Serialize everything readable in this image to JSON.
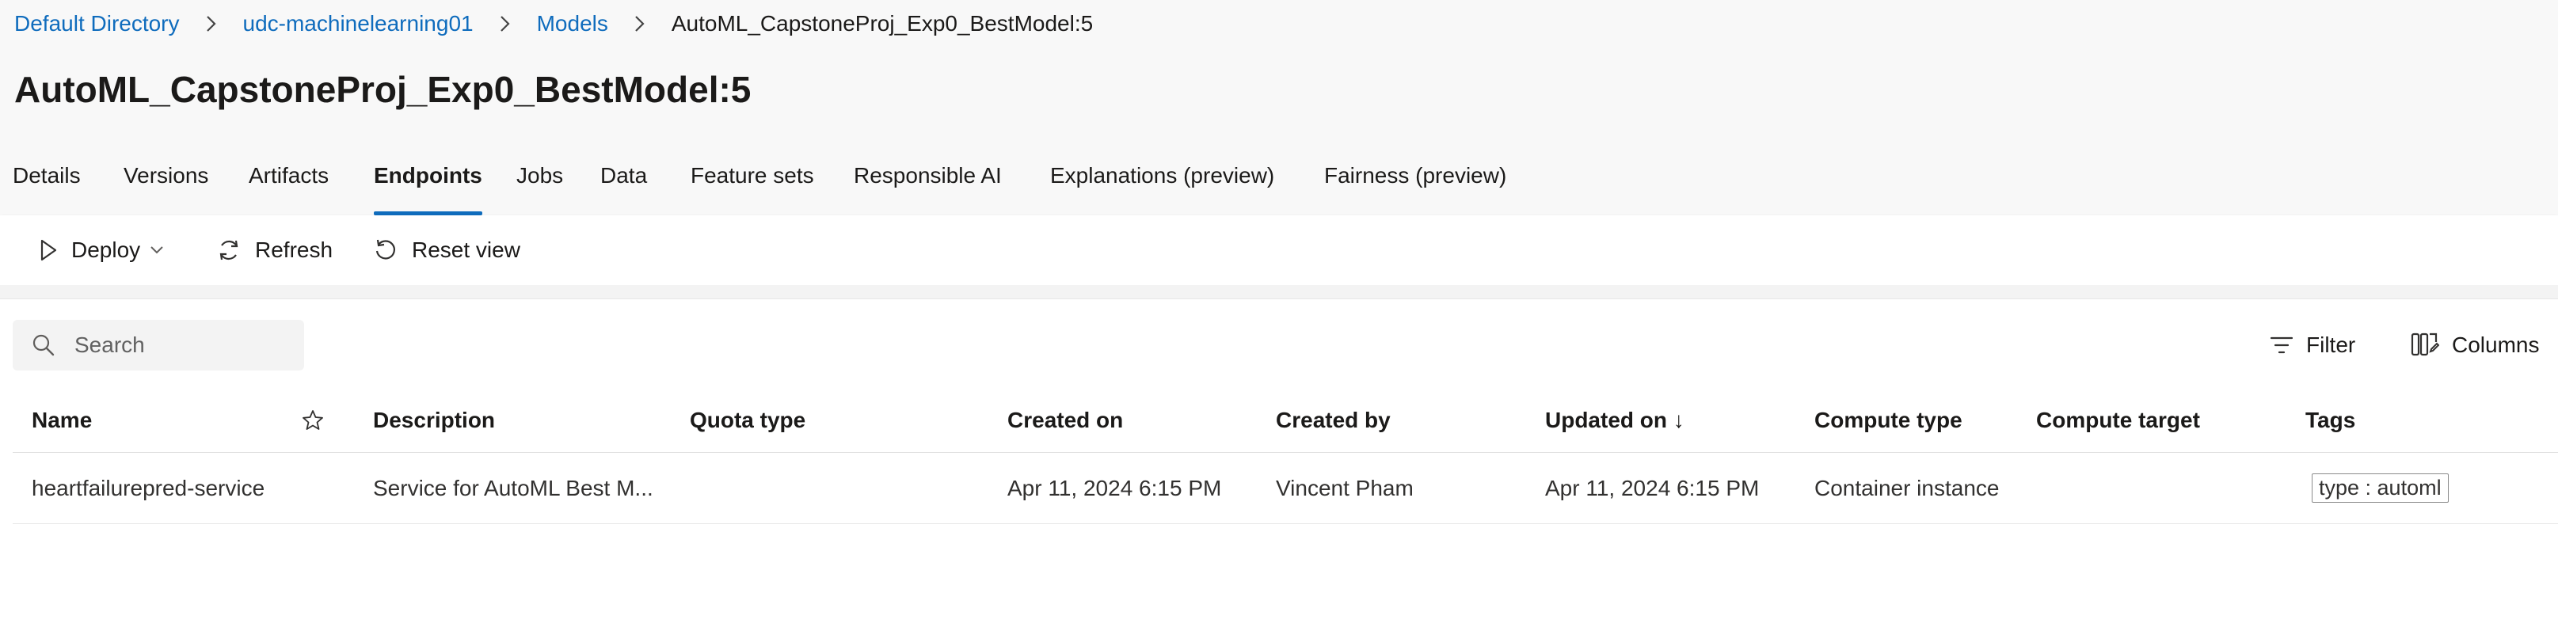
{
  "breadcrumb": {
    "items": [
      "Default Directory",
      "udc-machinelearning01",
      "Models"
    ],
    "current": "AutoML_CapstoneProj_Exp0_BestModel:5"
  },
  "page": {
    "title": "AutoML_CapstoneProj_Exp0_BestModel:5"
  },
  "tabs": [
    {
      "label": "Details"
    },
    {
      "label": "Versions"
    },
    {
      "label": "Artifacts"
    },
    {
      "label": "Endpoints",
      "active": true
    },
    {
      "label": "Jobs"
    },
    {
      "label": "Data"
    },
    {
      "label": "Feature sets"
    },
    {
      "label": "Responsible AI"
    },
    {
      "label": "Explanations (preview)"
    },
    {
      "label": "Fairness (preview)"
    }
  ],
  "toolbar": {
    "deploy_label": "Deploy",
    "refresh_label": "Refresh",
    "reset_view_label": "Reset view"
  },
  "search": {
    "placeholder": "Search",
    "value": ""
  },
  "actions": {
    "filter_label": "Filter",
    "columns_label": "Columns"
  },
  "table": {
    "columns": [
      "Name",
      "Description",
      "Quota type",
      "Created on",
      "Created by",
      "Updated on ↓",
      "Compute type",
      "Compute target",
      "Tags"
    ],
    "rows": [
      {
        "name": "heartfailurepred-service",
        "description": "Service for AutoML Best M...",
        "quota_type": "",
        "created_on": "Apr 11, 2024 6:15 PM",
        "created_by": "Vincent Pham",
        "updated_on": "Apr 11, 2024 6:15 PM",
        "compute_type": "Container instance",
        "compute_target": "",
        "tags": "type : automl"
      }
    ]
  },
  "icons": {
    "chevron": "chevron-right-icon",
    "deploy": "play-icon",
    "refresh": "refresh-icon",
    "reset": "reset-icon",
    "search": "search-icon",
    "filter": "filter-icon",
    "columns": "columns-icon",
    "favorite": "star-icon"
  },
  "colors": {
    "accent": "#0f6cbd",
    "header_bg": "#f8f8f8",
    "text": "#1b1a19"
  }
}
